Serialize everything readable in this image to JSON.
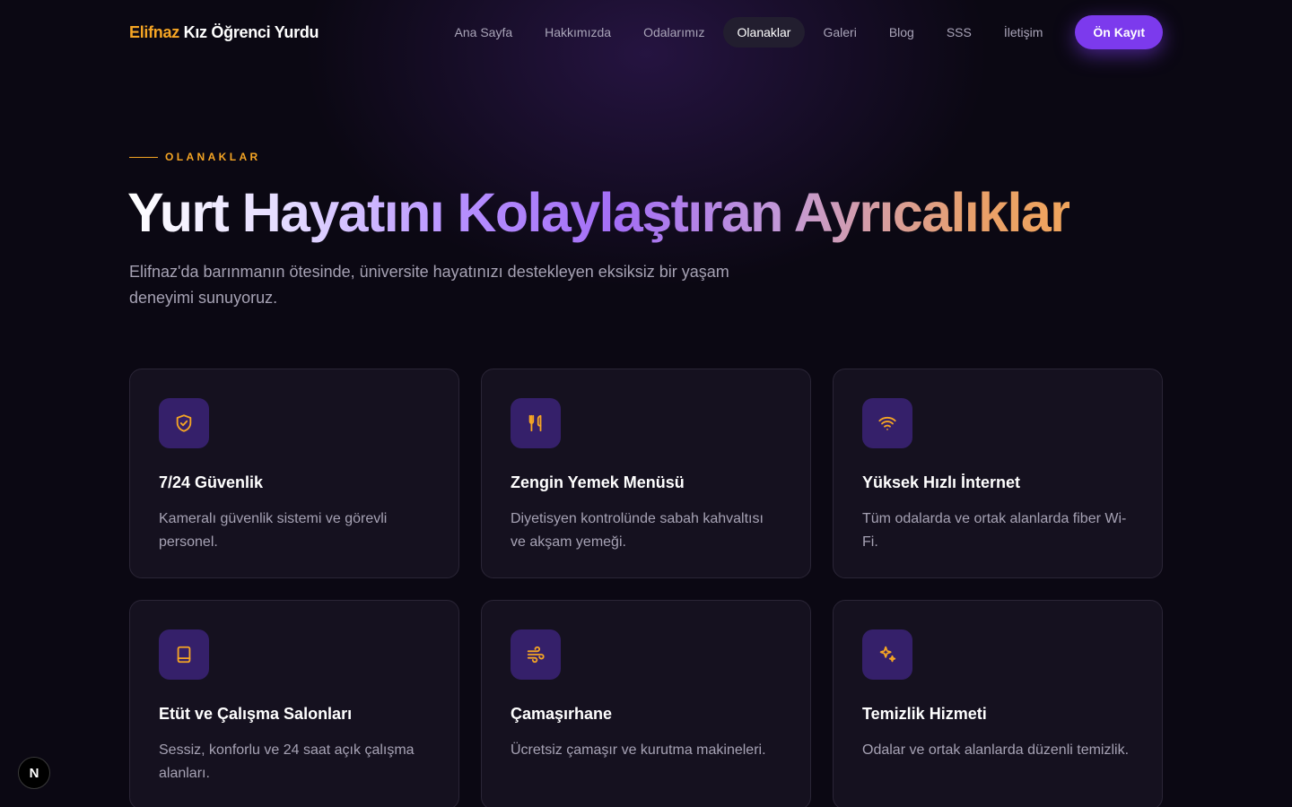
{
  "brand": {
    "accent": "Elifnaz",
    "rest": "Kız Öğrenci Yurdu"
  },
  "nav": {
    "items": [
      {
        "label": "Ana Sayfa"
      },
      {
        "label": "Hakkımızda"
      },
      {
        "label": "Odalarımız"
      },
      {
        "label": "Olanaklar",
        "active": true
      },
      {
        "label": "Galeri"
      },
      {
        "label": "Blog"
      },
      {
        "label": "SSS"
      },
      {
        "label": "İletişim"
      }
    ],
    "cta": "Ön Kayıt"
  },
  "hero": {
    "eyebrow": "OLANAKLAR",
    "title": "Yurt Hayatını Kolaylaştıran Ayrıcalıklar",
    "subtitle": "Elifnaz'da barınmanın ötesinde, üniversite hayatınızı destekleyen eksiksiz bir yaşam deneyimi sunuyoruz."
  },
  "features": [
    {
      "icon": "shield-check-icon",
      "title": "7/24 Güvenlik",
      "description": "Kameralı güvenlik sistemi ve görevli personel."
    },
    {
      "icon": "utensils-icon",
      "title": "Zengin Yemek Menüsü",
      "description": "Diyetisyen kontrolünde sabah kahvaltısı ve akşam yemeği."
    },
    {
      "icon": "wifi-icon",
      "title": "Yüksek Hızlı İnternet",
      "description": "Tüm odalarda ve ortak alanlarda fiber Wi-Fi."
    },
    {
      "icon": "book-icon",
      "title": "Etüt ve Çalışma Salonları",
      "description": "Sessiz, konforlu ve 24 saat açık çalışma alanları."
    },
    {
      "icon": "wind-icon",
      "title": "Çamaşırhane",
      "description": "Ücretsiz çamaşır ve kurutma makineleri."
    },
    {
      "icon": "sparkles-icon",
      "title": "Temizlik Hizmeti",
      "description": "Odalar ve ortak alanlarda düzenli temizlik."
    }
  ],
  "dev_badge": {
    "label": "N",
    "icon": "nextjs-logo-icon"
  },
  "colors": {
    "background": "#0b0813",
    "accent_orange": "#f5a524",
    "accent_purple": "#7c3aed",
    "card_background": "#15111f",
    "icon_tile": "#35206a"
  }
}
